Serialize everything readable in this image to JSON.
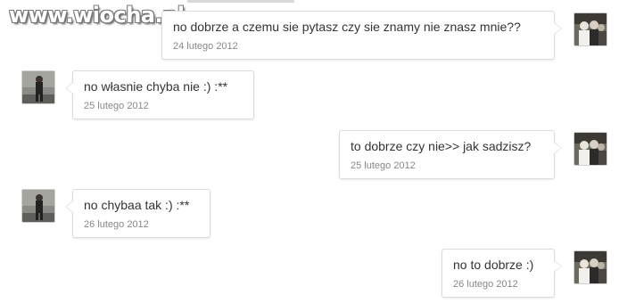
{
  "watermark": "www.wiocha.pl",
  "messages": [
    {
      "side": "right",
      "text": "no dobrze a czemu sie pytasz czy sie znamy nie znasz mnie??",
      "date": "24 lutego 2012"
    },
    {
      "side": "left",
      "text": "no własnie chyba nie :) :**",
      "date": "25 lutego 2012"
    },
    {
      "side": "right",
      "text": "to dobrze czy nie>> jak sadzisz?",
      "date": "25 lutego 2012"
    },
    {
      "side": "left",
      "text": "no chybaa tak :) :**",
      "date": "26 lutego 2012"
    },
    {
      "side": "right",
      "text": "no to dobrze :)",
      "date": "26 lutego 2012"
    }
  ]
}
